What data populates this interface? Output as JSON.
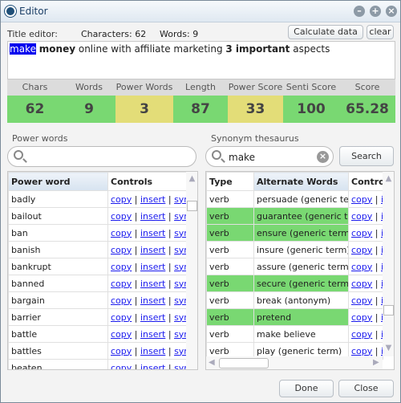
{
  "window": {
    "title": "Editor"
  },
  "editor": {
    "label": "Title editor:",
    "characters": "Characters: 62",
    "words": "Words: 9",
    "calculate_label": "Calculate data",
    "clear_label": "clear",
    "text": [
      {
        "t": "make",
        "s": "sel"
      },
      {
        "t": " "
      },
      {
        "t": "money",
        "s": "b"
      },
      {
        "t": " online with affiliate marketing "
      },
      {
        "t": "3 important",
        "s": "b"
      },
      {
        "t": " aspects"
      }
    ]
  },
  "stats": [
    {
      "label": "Chars",
      "value": "62",
      "color": "#79d872"
    },
    {
      "label": "Words",
      "value": "9",
      "color": "#79d872"
    },
    {
      "label": "Power Words",
      "value": "3",
      "color": "#e3dd78"
    },
    {
      "label": "Length Score",
      "value": "87",
      "color": "#79d872"
    },
    {
      "label": "Power Score",
      "value": "33",
      "color": "#e3dd78"
    },
    {
      "label": "Senti Score",
      "value": "100",
      "color": "#79d872"
    },
    {
      "label": "Score",
      "value": "65.28",
      "color": "#79d872"
    }
  ],
  "power": {
    "label": "Power words",
    "search_value": "",
    "headers": [
      "Power word",
      "Controls"
    ],
    "links": [
      "copy",
      "insert",
      "syns"
    ],
    "rows": [
      "badly",
      "bailout",
      "ban",
      "banish",
      "bankrupt",
      "banned",
      "bargain",
      "barrier",
      "battle",
      "battles",
      "beaten"
    ]
  },
  "synonym": {
    "label": "Synonym thesaurus",
    "search_value": "make",
    "search_label": "Search",
    "headers": [
      "Type",
      "Alternate Words",
      "Controls"
    ],
    "links": [
      "copy",
      "in"
    ],
    "rows": [
      {
        "type": "verb",
        "word": "persuade (generic term)",
        "hl": false
      },
      {
        "type": "verb",
        "word": "guarantee (generic term)",
        "hl": true
      },
      {
        "type": "verb",
        "word": "ensure (generic term)",
        "hl": true
      },
      {
        "type": "verb",
        "word": "insure (generic term)",
        "hl": false
      },
      {
        "type": "verb",
        "word": "assure (generic term)",
        "hl": false
      },
      {
        "type": "verb",
        "word": "secure (generic term)",
        "hl": true
      },
      {
        "type": "verb",
        "word": "break (antonym)",
        "hl": false
      },
      {
        "type": "verb",
        "word": "pretend",
        "hl": true
      },
      {
        "type": "verb",
        "word": "make believe",
        "hl": false
      },
      {
        "type": "verb",
        "word": "play (generic term)",
        "hl": false
      }
    ]
  },
  "footer": {
    "done_label": "Done",
    "close_label": "Close"
  }
}
